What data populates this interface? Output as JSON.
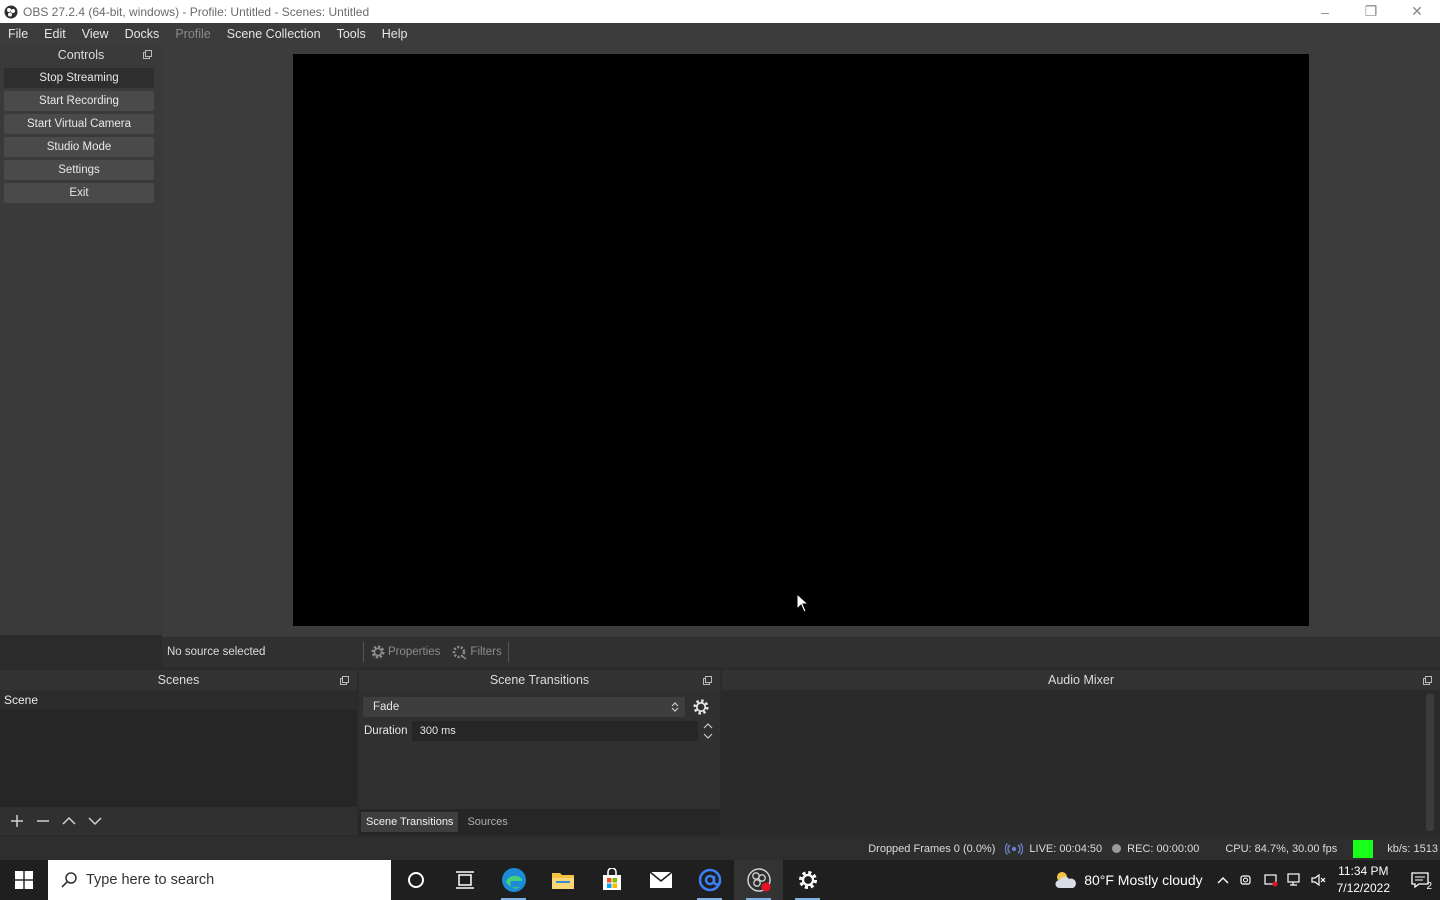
{
  "window": {
    "title": "OBS 27.2.4 (64-bit, windows) - Profile: Untitled - Scenes: Untitled",
    "minimize": "–",
    "restore": "❐",
    "close": "✕"
  },
  "menu": [
    {
      "label": "File",
      "enabled": true
    },
    {
      "label": "Edit",
      "enabled": true
    },
    {
      "label": "View",
      "enabled": true
    },
    {
      "label": "Docks",
      "enabled": true
    },
    {
      "label": "Profile",
      "enabled": false
    },
    {
      "label": "Scene Collection",
      "enabled": true
    },
    {
      "label": "Tools",
      "enabled": true
    },
    {
      "label": "Help",
      "enabled": true
    }
  ],
  "controls": {
    "title": "Controls",
    "buttons": [
      {
        "label": "Stop Streaming",
        "active": true
      },
      {
        "label": "Start Recording"
      },
      {
        "label": "Start Virtual Camera"
      },
      {
        "label": "Studio Mode"
      },
      {
        "label": "Settings"
      },
      {
        "label": "Exit"
      }
    ]
  },
  "source_bar": {
    "status": "No source selected",
    "properties": "Properties",
    "filters": "Filters"
  },
  "scenes": {
    "title": "Scenes",
    "items": [
      "Scene"
    ]
  },
  "transitions": {
    "title": "Scene Transitions",
    "selected": "Fade",
    "duration_label": "Duration",
    "duration_value": "300 ms",
    "tabs": [
      "Scene Transitions",
      "Sources"
    ]
  },
  "mixer": {
    "title": "Audio Mixer"
  },
  "status": {
    "dropped": "Dropped Frames 0 (0.0%)",
    "live": "LIVE: 00:04:50",
    "rec": "REC: 00:00:00",
    "cpu": "CPU: 84.7%, 30.00 fps",
    "kbps": "kb/s: 1513",
    "health_color": "#19ff19"
  },
  "taskbar": {
    "search_placeholder": "Type here to search",
    "apps": [
      "cortana-icon",
      "task-view-icon",
      "edge-icon",
      "file-explorer-icon",
      "store-icon",
      "mail-icon",
      "at-app-icon",
      "obs-icon",
      "settings-icon"
    ],
    "weather": "80°F  Mostly cloudy",
    "time": "11:34 PM",
    "date": "7/12/2022",
    "notifications": "2"
  }
}
